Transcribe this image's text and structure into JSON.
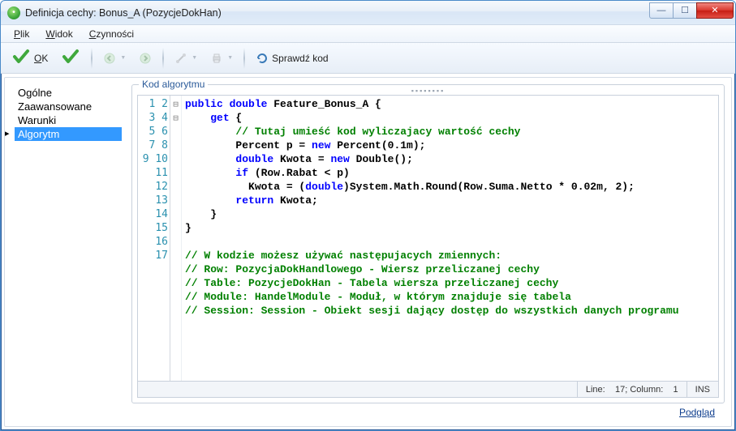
{
  "window": {
    "title": "Definicja cechy: Bonus_A (PozycjeDokHan)"
  },
  "menu": {
    "file": "Plik",
    "view": "Widok",
    "actions": "Czynności"
  },
  "toolbar": {
    "ok_label": "OK",
    "check_code_label": "Sprawdź kod"
  },
  "nav": {
    "items": [
      {
        "label": "Ogólne"
      },
      {
        "label": "Zaawansowane"
      },
      {
        "label": "Warunki"
      },
      {
        "label": "Algorytm",
        "selected": true
      }
    ]
  },
  "editor": {
    "legend": "Kod algorytmu",
    "lines": [
      "public double Feature_Bonus_A {",
      "    get {",
      "        // Tutaj umieść kod wyliczajacy wartość cechy",
      "        Percent p = new Percent(0.1m);",
      "        double Kwota = new Double();",
      "        if (Row.Rabat < p)",
      "          Kwota = (double)System.Math.Round(Row.Suma.Netto * 0.02m, 2);",
      "        return Kwota;",
      "    }",
      "}",
      "",
      "// W kodzie możesz używać następujacych zmiennych:",
      "// Row: PozycjaDokHandlowego - Wiersz przeliczanej cechy",
      "// Table: PozycjeDokHan - Tabela wiersza przeliczanej cechy",
      "// Module: HandelModule - Moduł, w którym znajduje się tabela",
      "// Session: Session - Obiekt sesji dający dostęp do wszystkich danych programu",
      ""
    ],
    "status": {
      "line_label": "Line:",
      "line": 17,
      "col_label": "Column:",
      "col": 1,
      "mode": "INS"
    }
  },
  "footer": {
    "preview": "Podgląd"
  }
}
